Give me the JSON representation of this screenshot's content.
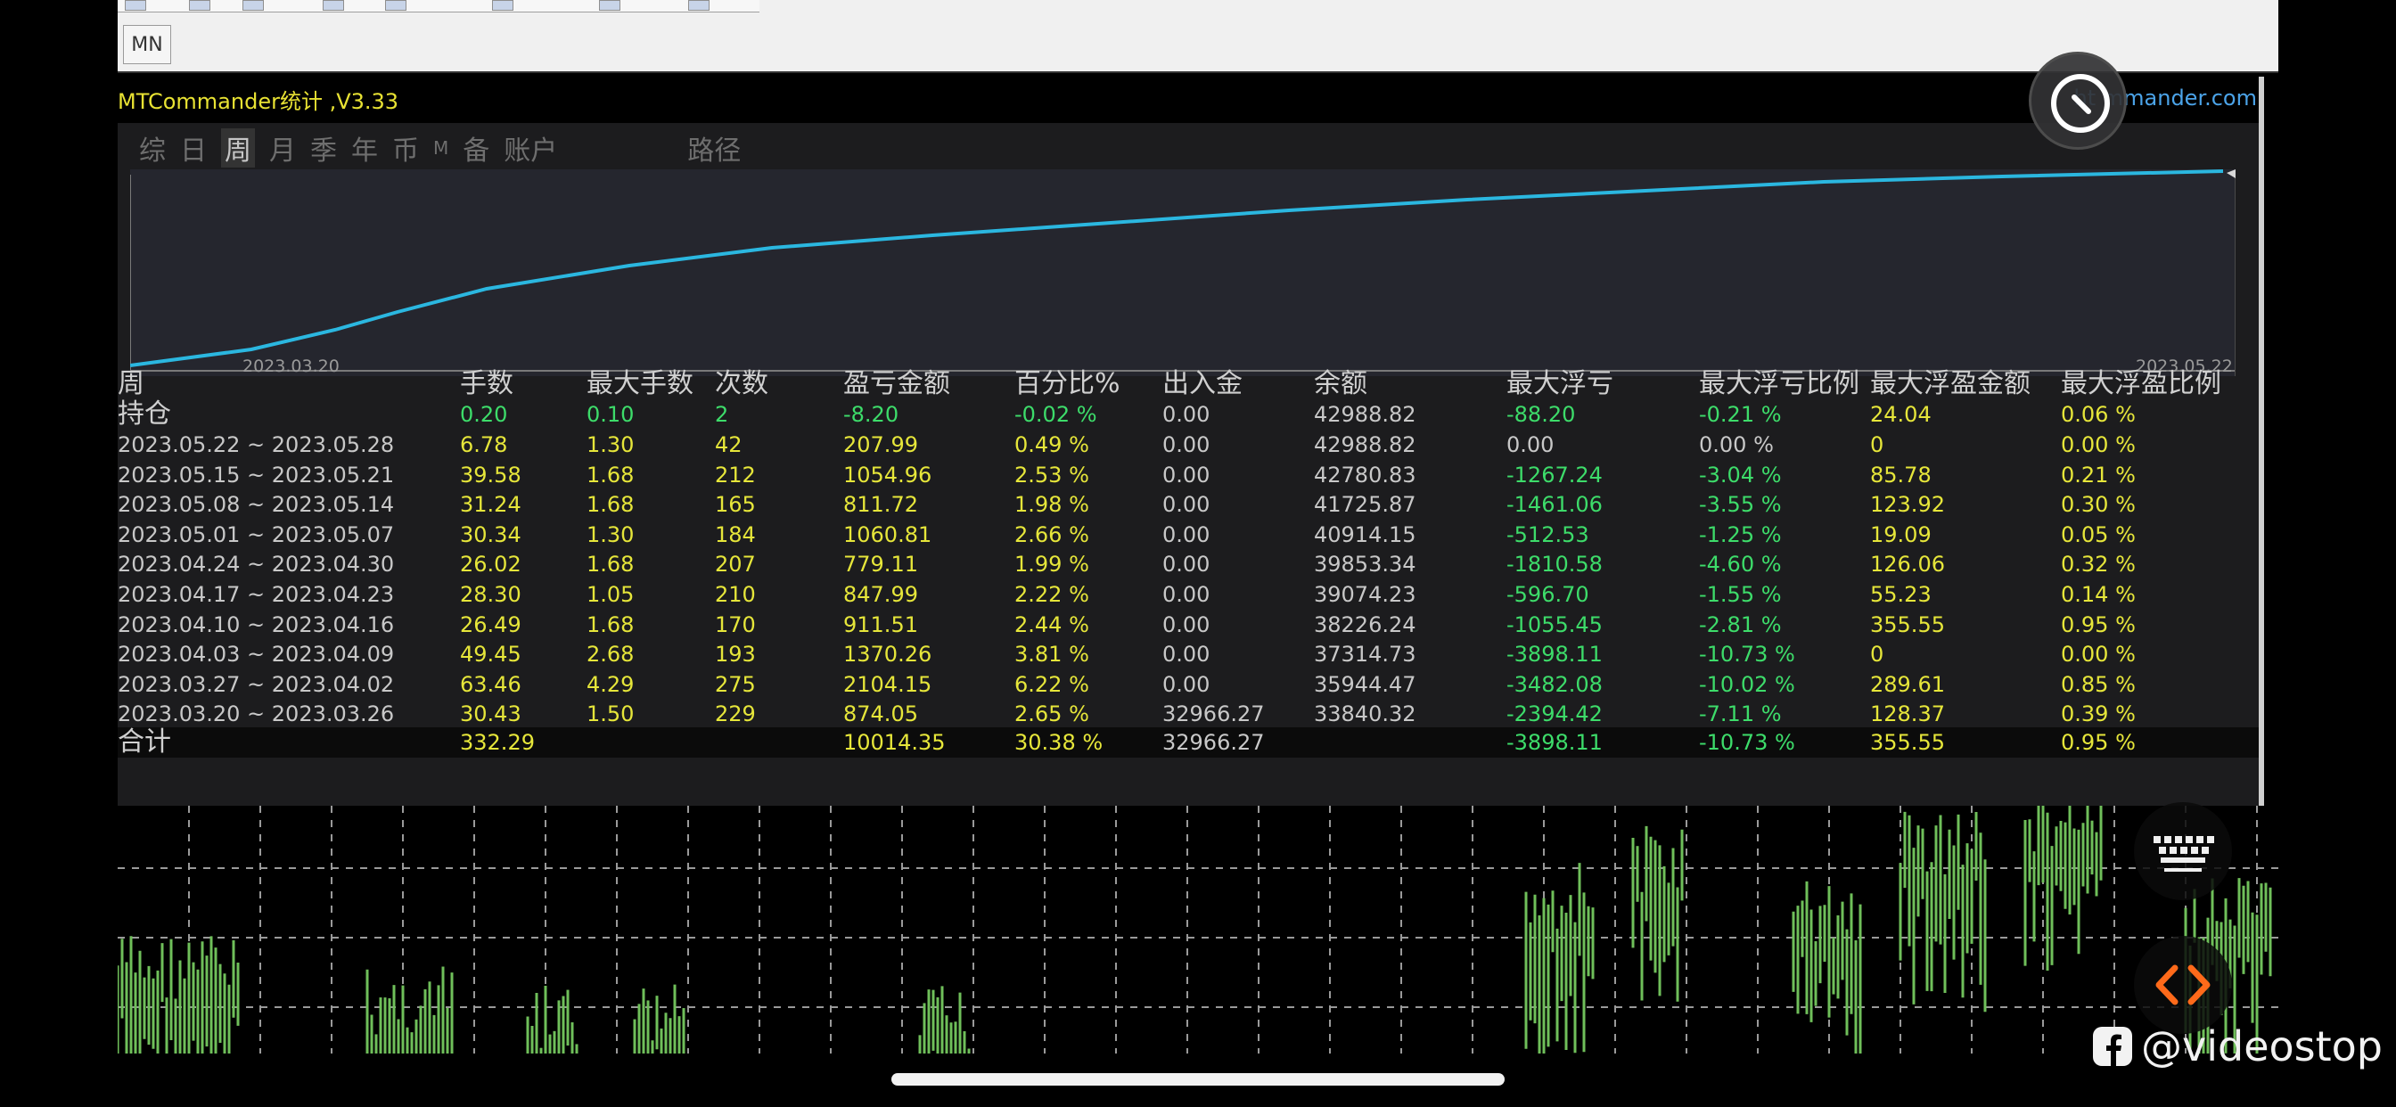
{
  "toolbar": {
    "timeframe_label": "MN"
  },
  "panel": {
    "title": "MTCommander统计 ,V3.33",
    "url_partial": "ht    mmander.com",
    "nav_tabs": [
      "综",
      "日",
      "周",
      "月",
      "季",
      "年",
      "币",
      "M",
      "备",
      "账户",
      "路径"
    ],
    "active_tab": "周"
  },
  "equity_chart": {
    "start_date": "2023.03.20",
    "end_date": "2023.05.22",
    "line_color": "#2bb7e0"
  },
  "table": {
    "headers": [
      "周",
      "手数",
      "最大手数",
      "次数",
      "盈亏金额",
      "百分比%",
      "出入金",
      "余额",
      "最大浮亏",
      "最大浮亏比例",
      "最大浮盈金额",
      "最大浮盈比例"
    ],
    "holding": {
      "label": "持仓",
      "lots": "0.20",
      "max_lots": "0.10",
      "count": "2",
      "pnl": "-8.20",
      "pct": "-0.02 %",
      "flow": "0.00",
      "balance": "42988.82",
      "max_dd": "-88.20",
      "max_dd_pct": "-0.21 %",
      "max_fp": "24.04",
      "max_fp_pct": "0.06 %"
    },
    "rows": [
      {
        "period": "2023.05.22 ~ 2023.05.28",
        "lots": "6.78",
        "max_lots": "1.30",
        "count": "42",
        "pnl": "207.99",
        "pct": "0.49 %",
        "flow": "0.00",
        "balance": "42988.82",
        "max_dd": "0.00",
        "max_dd_pct": "0.00 %",
        "max_fp": "0",
        "max_fp_pct": "0.00 %"
      },
      {
        "period": "2023.05.15 ~ 2023.05.21",
        "lots": "39.58",
        "max_lots": "1.68",
        "count": "212",
        "pnl": "1054.96",
        "pct": "2.53 %",
        "flow": "0.00",
        "balance": "42780.83",
        "max_dd": "-1267.24",
        "max_dd_pct": "-3.04 %",
        "max_fp": "85.78",
        "max_fp_pct": "0.21 %"
      },
      {
        "period": "2023.05.08 ~ 2023.05.14",
        "lots": "31.24",
        "max_lots": "1.68",
        "count": "165",
        "pnl": "811.72",
        "pct": "1.98 %",
        "flow": "0.00",
        "balance": "41725.87",
        "max_dd": "-1461.06",
        "max_dd_pct": "-3.55 %",
        "max_fp": "123.92",
        "max_fp_pct": "0.30 %"
      },
      {
        "period": "2023.05.01 ~ 2023.05.07",
        "lots": "30.34",
        "max_lots": "1.30",
        "count": "184",
        "pnl": "1060.81",
        "pct": "2.66 %",
        "flow": "0.00",
        "balance": "40914.15",
        "max_dd": "-512.53",
        "max_dd_pct": "-1.25 %",
        "max_fp": "19.09",
        "max_fp_pct": "0.05 %"
      },
      {
        "period": "2023.04.24 ~ 2023.04.30",
        "lots": "26.02",
        "max_lots": "1.68",
        "count": "207",
        "pnl": "779.11",
        "pct": "1.99 %",
        "flow": "0.00",
        "balance": "39853.34",
        "max_dd": "-1810.58",
        "max_dd_pct": "-4.60 %",
        "max_fp": "126.06",
        "max_fp_pct": "0.32 %"
      },
      {
        "period": "2023.04.17 ~ 2023.04.23",
        "lots": "28.30",
        "max_lots": "1.05",
        "count": "210",
        "pnl": "847.99",
        "pct": "2.22 %",
        "flow": "0.00",
        "balance": "39074.23",
        "max_dd": "-596.70",
        "max_dd_pct": "-1.55 %",
        "max_fp": "55.23",
        "max_fp_pct": "0.14 %"
      },
      {
        "period": "2023.04.10 ~ 2023.04.16",
        "lots": "26.49",
        "max_lots": "1.68",
        "count": "170",
        "pnl": "911.51",
        "pct": "2.44 %",
        "flow": "0.00",
        "balance": "38226.24",
        "max_dd": "-1055.45",
        "max_dd_pct": "-2.81 %",
        "max_fp": "355.55",
        "max_fp_pct": "0.95 %"
      },
      {
        "period": "2023.04.03 ~ 2023.04.09",
        "lots": "49.45",
        "max_lots": "2.68",
        "count": "193",
        "pnl": "1370.26",
        "pct": "3.81 %",
        "flow": "0.00",
        "balance": "37314.73",
        "max_dd": "-3898.11",
        "max_dd_pct": "-10.73 %",
        "max_fp": "0",
        "max_fp_pct": "0.00 %"
      },
      {
        "period": "2023.03.27 ~ 2023.04.02",
        "lots": "63.46",
        "max_lots": "4.29",
        "count": "275",
        "pnl": "2104.15",
        "pct": "6.22 %",
        "flow": "0.00",
        "balance": "35944.47",
        "max_dd": "-3482.08",
        "max_dd_pct": "-10.02 %",
        "max_fp": "289.61",
        "max_fp_pct": "0.85 %"
      },
      {
        "period": "2023.03.20 ~ 2023.03.26",
        "lots": "30.43",
        "max_lots": "1.50",
        "count": "229",
        "pnl": "874.05",
        "pct": "2.65 %",
        "flow": "32966.27",
        "balance": "33840.32",
        "max_dd": "-2394.42",
        "max_dd_pct": "-7.11 %",
        "max_fp": "128.37",
        "max_fp_pct": "0.39 %"
      }
    ],
    "total": {
      "label": "合计",
      "lots": "332.29",
      "max_lots": "",
      "count": "",
      "pnl": "10014.35",
      "pct": "30.38 %",
      "flow": "32966.27",
      "balance": "",
      "max_dd": "-3898.11",
      "max_dd_pct": "-10.73 %",
      "max_fp": "355.55",
      "max_fp_pct": "0.95 %"
    }
  },
  "colors": {
    "yellow": "#e6e63a",
    "green": "#3ddc6a",
    "gray": "#c8c8c8",
    "bar_green": "#6fbf5a",
    "grid": "#9a9a9a"
  },
  "overlays": {
    "watermark": "@videostop",
    "compass_icon": "compass-icon",
    "keyboard_icon": "keyboard-icon",
    "code_icon": "code-icon"
  }
}
